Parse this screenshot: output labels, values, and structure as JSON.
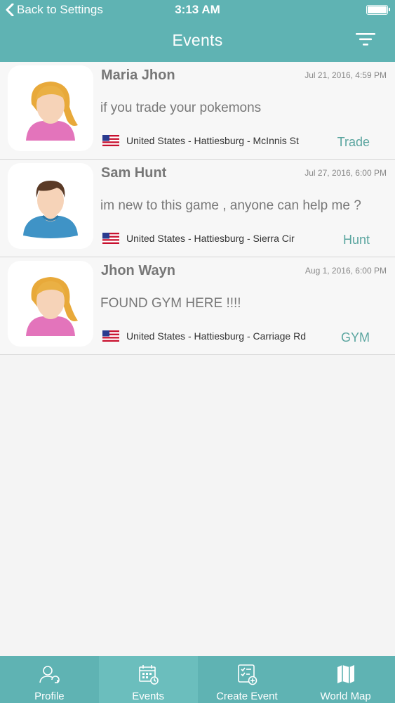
{
  "status": {
    "back_label": "Back to Settings",
    "time": "3:13 AM"
  },
  "header": {
    "title": "Events"
  },
  "events": [
    {
      "name": "Maria Jhon",
      "date": "Jul 21, 2016, 4:59 PM",
      "message": "if you trade your pokemons",
      "location": "United States - Hattiesburg - McInnis St",
      "tag": "Trade",
      "avatar": "female-avatar-icon"
    },
    {
      "name": "Sam Hunt",
      "date": "Jul 27, 2016, 6:00 PM",
      "message": "im new to this game , anyone can help me ?",
      "location": "United States - Hattiesburg - Sierra Cir",
      "tag": "Hunt",
      "avatar": "male-avatar-icon"
    },
    {
      "name": "Jhon Wayn",
      "date": "Aug 1, 2016, 6:00 PM",
      "message": "FOUND GYM HERE !!!!",
      "location": "United States - Hattiesburg - Carriage Rd",
      "tag": "GYM",
      "avatar": "female-avatar-icon"
    }
  ],
  "tabs": [
    {
      "label": "Profile",
      "icon": "profile-icon"
    },
    {
      "label": "Events",
      "icon": "calendar-icon"
    },
    {
      "label": "Create Event",
      "icon": "create-event-icon"
    },
    {
      "label": "World Map",
      "icon": "map-icon"
    }
  ],
  "colors": {
    "primary": "#5fb3b3",
    "active_tab": "#6bbebd",
    "tag_text": "#5aa59f"
  }
}
